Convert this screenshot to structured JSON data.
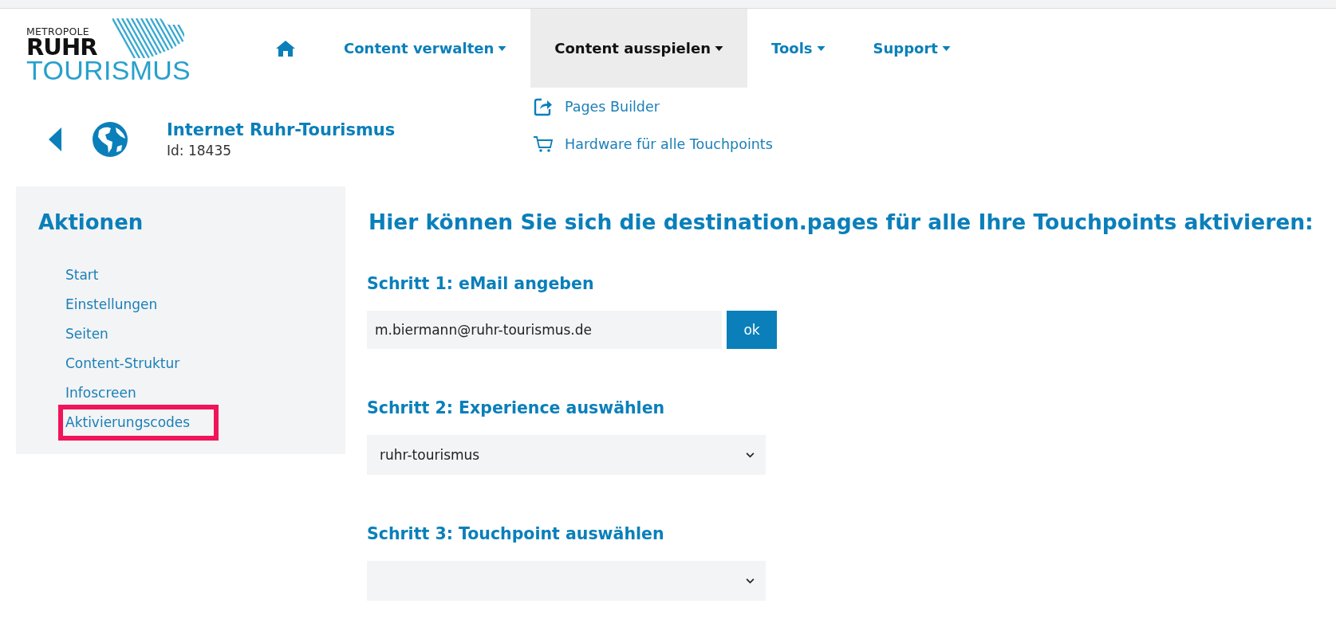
{
  "logo": {
    "line_1": "METROPOLE",
    "line_2": "RUHR",
    "line_3": "TOURISMUS"
  },
  "nav": {
    "items": [
      {
        "kind": "home",
        "selected": false
      },
      {
        "kind": "menu",
        "label": "Content verwalten",
        "selected": false
      },
      {
        "kind": "menu",
        "label": "Content ausspielen",
        "selected": true
      },
      {
        "kind": "menu",
        "label": "Tools",
        "selected": false
      },
      {
        "kind": "menu",
        "label": "Support",
        "selected": false
      }
    ]
  },
  "dropdown": {
    "items": [
      {
        "kind": "share",
        "label": "Pages Builder"
      },
      {
        "kind": "cart",
        "label": "Hardware für alle Touchpoints"
      }
    ]
  },
  "header": {
    "title": "Internet Ruhr-Tourismus",
    "id": "Id: 18435"
  },
  "sidebar": {
    "title": "Aktionen",
    "items": [
      {
        "label": "Start",
        "highlighted": false
      },
      {
        "label": "Einstellungen",
        "highlighted": false
      },
      {
        "label": "Seiten",
        "highlighted": false
      },
      {
        "label": "Content-Struktur",
        "highlighted": false
      },
      {
        "label": "Infoscreen",
        "highlighted": false
      },
      {
        "label": "Aktivierungscodes",
        "highlighted": true
      }
    ]
  },
  "main": {
    "heading": "Hier können Sie sich die destination.pages für alle Ihre Touchpoints aktivieren:",
    "steps": [
      {
        "kind": "email",
        "title": "Schritt 1: eMail angeben",
        "value": "m.biermann@ruhr-tourismus.de",
        "button": "ok"
      },
      {
        "kind": "select",
        "title": "Schritt 2: Experience auswählen",
        "value": "ruhr-tourismus"
      },
      {
        "kind": "select",
        "title": "Schritt 3: Touchpoint auswählen"
      }
    ]
  }
}
